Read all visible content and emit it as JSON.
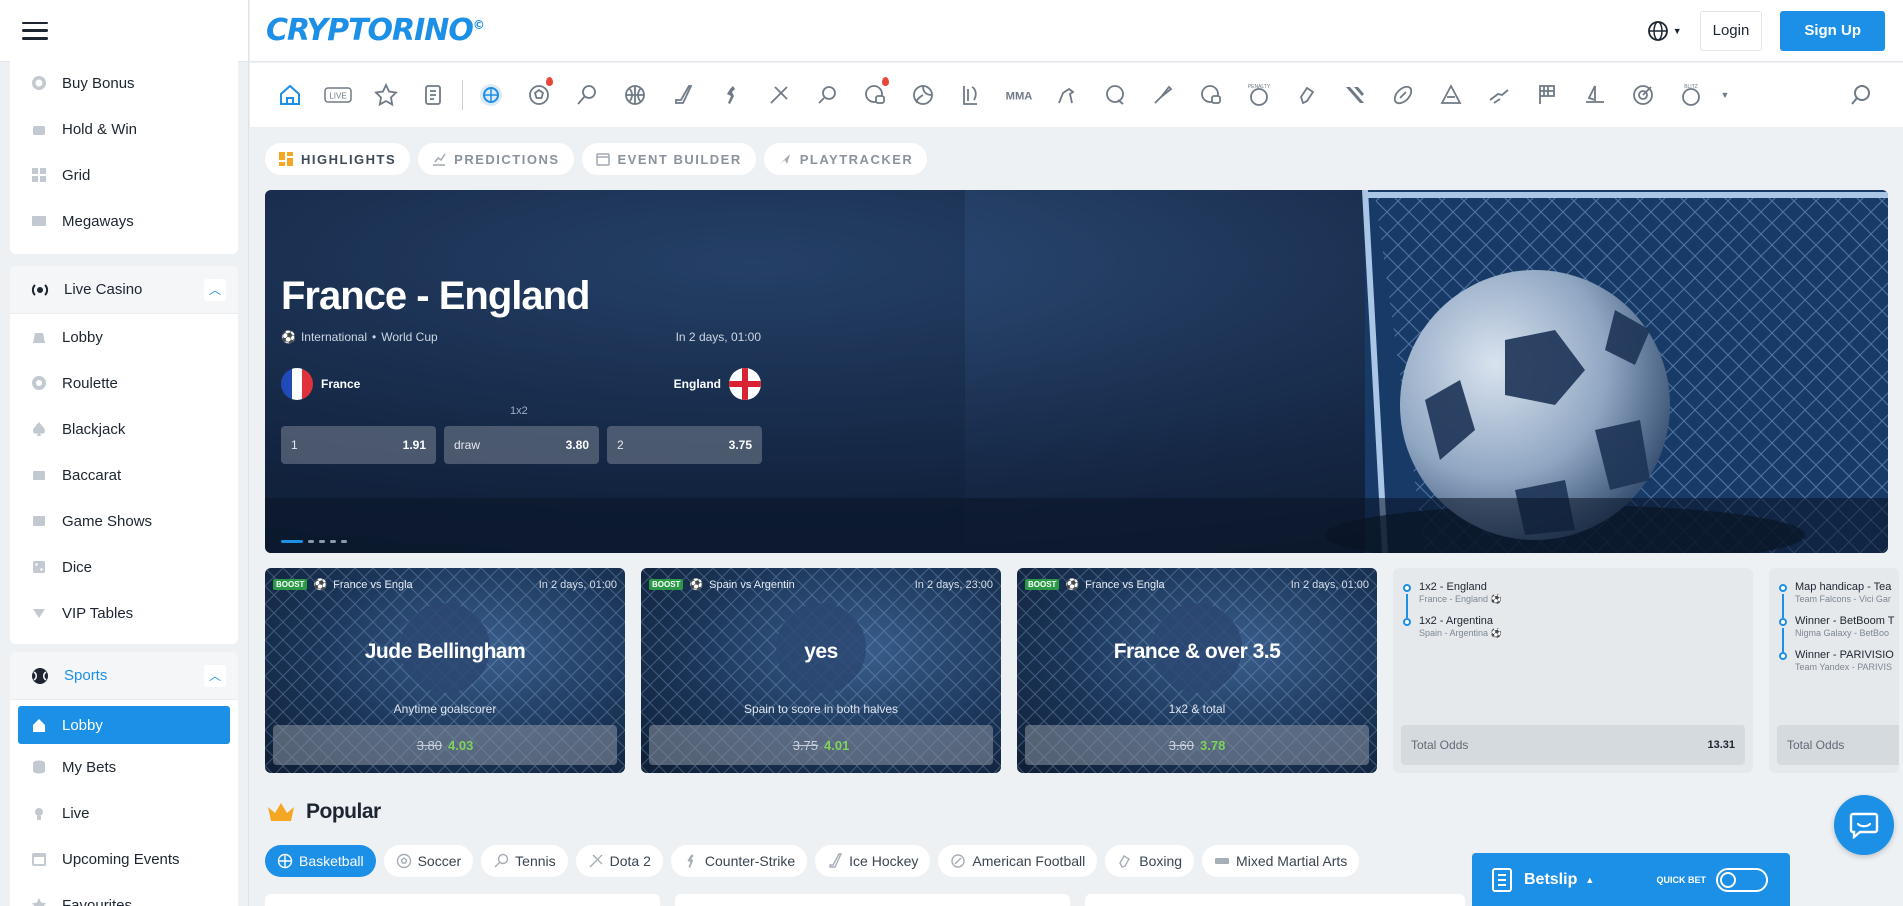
{
  "header": {
    "logo": "CRYPTORINO",
    "logo_mark": "©",
    "login": "Login",
    "signup": "Sign Up"
  },
  "sidebar": {
    "casino_items": [
      "Buy Bonus",
      "Hold & Win",
      "Grid",
      "Megaways"
    ],
    "live_casino": {
      "title": "Live Casino",
      "items": [
        "Lobby",
        "Roulette",
        "Blackjack",
        "Baccarat",
        "Game Shows",
        "Dice",
        "VIP Tables"
      ]
    },
    "sports": {
      "title": "Sports",
      "items": [
        "Lobby",
        "My Bets",
        "Live",
        "Upcoming Events",
        "Favourites"
      ]
    }
  },
  "sport_icons": [
    "home",
    "live",
    "favourites",
    "betslip",
    "sports-all",
    "soccer",
    "tennis",
    "basketball",
    "ice-hockey",
    "counter-strike",
    "dota-2",
    "table-tennis",
    "fifa",
    "volleyball",
    "league-of-legends",
    "mma",
    "horse-racing",
    "golf",
    "badminton",
    "soccer-virtual",
    "penalty",
    "boxing",
    "esports",
    "american-football",
    "handball",
    "cycling",
    "racing",
    "kabaddi",
    "darts",
    "blitz"
  ],
  "sport_icon_labels": {
    "live": "LIVE",
    "mma": "MMA",
    "penalty": "PENALTY",
    "blitz": "BLITZ"
  },
  "tabs": [
    "HIGHLIGHTS",
    "PREDICTIONS",
    "EVENT BUILDER",
    "PLAYTRACKER"
  ],
  "hero": {
    "title": "France - England",
    "category": "International",
    "league": "World Cup",
    "time": "In 2 days, 01:00",
    "team1": "France",
    "team2": "England",
    "market": "1x2",
    "odds": [
      {
        "label": "1",
        "value": "1.91"
      },
      {
        "label": "draw",
        "value": "3.80"
      },
      {
        "label": "2",
        "value": "3.75"
      }
    ]
  },
  "boosts": [
    {
      "badge": "BOOST",
      "event": "France vs Engla",
      "time": "In 2 days, 01:00",
      "pick": "Jude Bellingham",
      "market": "Anytime goalscorer",
      "old": "3.80",
      "new": "4.03"
    },
    {
      "badge": "BOOST",
      "event": "Spain vs Argentin",
      "time": "In 2 days, 23:00",
      "pick": "yes",
      "market": "Spain to score in both halves",
      "old": "3.75",
      "new": "4.01"
    },
    {
      "badge": "BOOST",
      "event": "France vs Engla",
      "time": "In 2 days, 01:00",
      "pick": "France & over 3.5",
      "market": "1x2 & total",
      "old": "3.60",
      "new": "3.78"
    }
  ],
  "combos": [
    {
      "legs": [
        {
          "pick": "1x2 - England",
          "event": "France - England ⚽"
        },
        {
          "pick": "1x2 - Argentina",
          "event": "Spain - Argentina ⚽"
        }
      ],
      "total_label": "Total Odds",
      "total": "13.31"
    },
    {
      "legs": [
        {
          "pick": "Map handicap - Tea",
          "event": "Team Falcons - Vici Gar"
        },
        {
          "pick": "Winner - BetBoom T",
          "event": "Nigma Galaxy - BetBoo"
        },
        {
          "pick": "Winner - PARIVISIO",
          "event": "Team Yandex - PARIVIS"
        }
      ],
      "total_label": "Total Odds",
      "total": ""
    }
  ],
  "popular": {
    "title": "Popular",
    "chips": [
      "Basketball",
      "Soccer",
      "Tennis",
      "Dota 2",
      "Counter-Strike",
      "Ice Hockey",
      "American Football",
      "Boxing",
      "Mixed Martial Arts"
    ]
  },
  "betslip": {
    "label": "Betslip",
    "quick_bet": "QUICK BET"
  },
  "colors": {
    "accent": "#1c8fe6",
    "boost_green": "#2b9a47",
    "odd_up": "#7fd45a"
  }
}
